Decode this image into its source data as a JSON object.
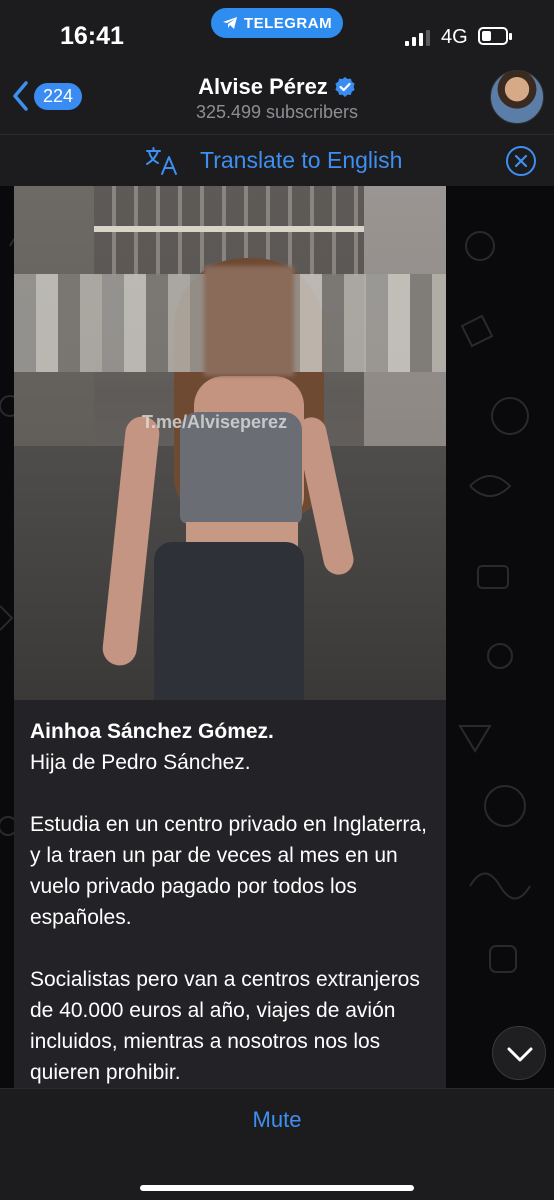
{
  "status_bar": {
    "time": "16:41",
    "pill": "TELEGRAM",
    "network": "4G"
  },
  "header": {
    "back_count": "224",
    "title": "Alvise Pérez",
    "subtitle": "325.499 subscribers"
  },
  "translate": {
    "label": "Translate to English"
  },
  "post": {
    "watermark": "T.me/Alviseperez",
    "title": "Ainhoa Sánchez Gómez.",
    "line2": "Hija de Pedro Sánchez.",
    "para2": "Estudia en un centro privado en Inglaterra, y la traen un par de veces al mes en un vuelo privado pagado por todos los españoles.",
    "para3": "Socialistas pero van a centros extranjeros de 40.000 euros al año, viajes de avión incluidos, mientras a nosotros nos los quieren prohibir."
  },
  "bottom": {
    "mute_label": "Mute"
  },
  "colors": {
    "accent": "#3e8ff0",
    "badge": "#3a8cf2",
    "pill": "#2f8df0"
  }
}
